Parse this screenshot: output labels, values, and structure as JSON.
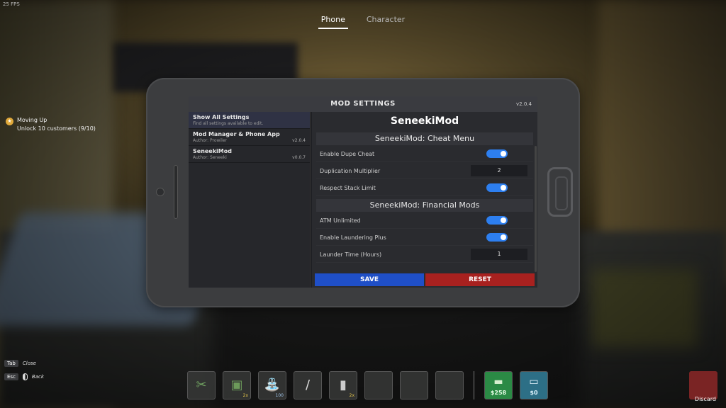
{
  "fps": "25 FPS",
  "tabs": [
    {
      "label": "Phone",
      "active": true
    },
    {
      "label": "Character",
      "active": false
    }
  ],
  "quest": {
    "title": "Moving Up",
    "subtitle": "Unlock 10 customers (9/10)"
  },
  "phone": {
    "app_title": "MOD SETTINGS",
    "version": "v2.0.4",
    "mods": [
      {
        "name": "Show All Settings",
        "desc": "Find all settings available to edit.",
        "version": ""
      },
      {
        "name": "Mod Manager & Phone App",
        "desc": "Author: Prowiler",
        "version": "v2.0.4"
      },
      {
        "name": "SeneekiMod",
        "desc": "Author: Seneeki",
        "version": "v0.0.7"
      }
    ],
    "selected_mod_title": "SeneekiMod",
    "sections": [
      {
        "title": "SeneekiMod: Cheat Menu",
        "settings": [
          {
            "label": "Enable Dupe Cheat",
            "type": "toggle",
            "value": true
          },
          {
            "label": "Duplication Multiplier",
            "type": "number",
            "value": "2"
          },
          {
            "label": "Respect Stack Limit",
            "type": "toggle",
            "value": true
          }
        ]
      },
      {
        "title": "SeneekiMod: Financial Mods",
        "settings": [
          {
            "label": "ATM Unlimited",
            "type": "toggle",
            "value": true
          },
          {
            "label": "Enable Laundering Plus",
            "type": "toggle",
            "value": true
          },
          {
            "label": "Launder Time (Hours)",
            "type": "number",
            "value": "1"
          }
        ]
      }
    ],
    "save_label": "SAVE",
    "reset_label": "RESET"
  },
  "hints": [
    {
      "key": "Tab",
      "action": "Close"
    },
    {
      "key": "Esc",
      "action": "Back"
    }
  ],
  "hotbar": {
    "slots": [
      {
        "icon": "trimmers-icon",
        "qty": ""
      },
      {
        "icon": "soil-bag-icon",
        "qty": "2x"
      },
      {
        "icon": "watering-can-icon",
        "qty": "100"
      },
      {
        "icon": "pen-icon",
        "qty": ""
      },
      {
        "icon": "seed-packet-icon",
        "qty": "2x"
      },
      {
        "icon": "",
        "qty": ""
      },
      {
        "icon": "",
        "qty": ""
      },
      {
        "icon": "",
        "qty": ""
      }
    ],
    "cash": "$258",
    "card": "$0",
    "discard_label": "Discard"
  },
  "colors": {
    "accent_blue": "#2d7ff0",
    "save": "#1f4fc7",
    "reset": "#a8211f",
    "cash": "#2b8a45",
    "card": "#2d6f86"
  }
}
